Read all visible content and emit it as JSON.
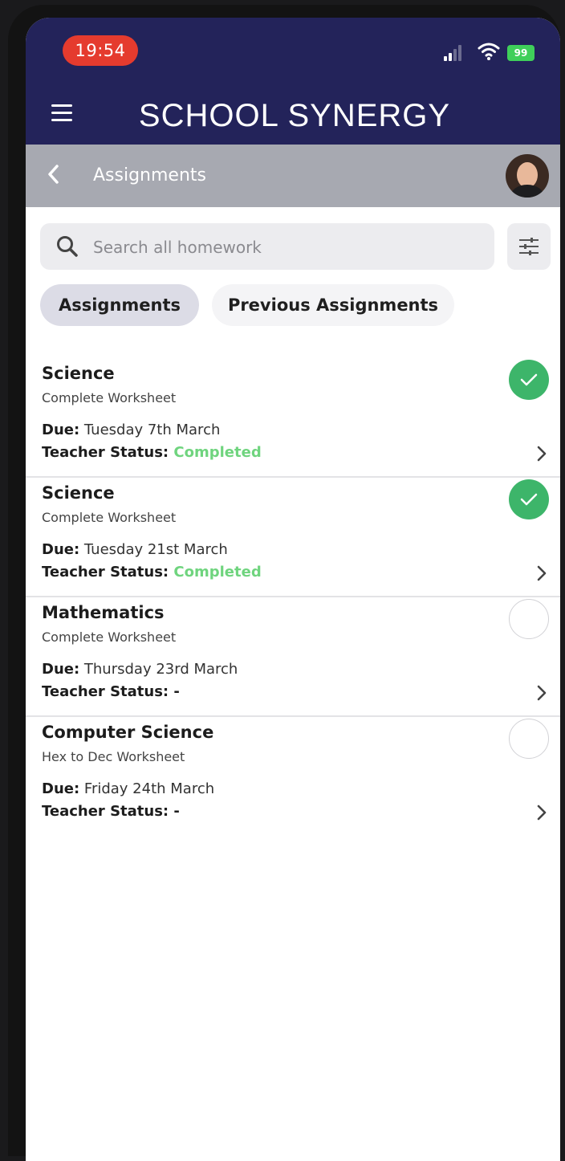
{
  "status_bar": {
    "time": "19:54",
    "battery": "99"
  },
  "header": {
    "brand": "SCHOOL SYNERGY"
  },
  "subheader": {
    "title": "Assignments"
  },
  "search": {
    "placeholder": "Search all homework"
  },
  "tabs": [
    {
      "label": "Assignments",
      "active": true
    },
    {
      "label": "Previous Assignments",
      "active": false
    }
  ],
  "labels": {
    "due": "Due:",
    "teacher_status": "Teacher Status:"
  },
  "assignments": [
    {
      "subject": "Science",
      "task": "Complete Worksheet",
      "due": "Tuesday 7th March",
      "status": "Completed",
      "done": true
    },
    {
      "subject": "Science",
      "task": "Complete Worksheet",
      "due": "Tuesday 21st March",
      "status": "Completed",
      "done": true
    },
    {
      "subject": "Mathematics",
      "task": "Complete Worksheet",
      "due": "Thursday 23rd March",
      "status": "-",
      "done": false
    },
    {
      "subject": "Computer Science",
      "task": "Hex to Dec Worksheet",
      "due": "Friday 24th March",
      "status": "-",
      "done": false
    }
  ],
  "colors": {
    "header_bg": "#23235a",
    "subheader_bg": "#a7a9b1",
    "done_green": "#3db56a",
    "completed_text": "#6fd47e",
    "time_pill": "#e53b2e"
  },
  "icons": {
    "menu": "hamburger-icon",
    "back": "chevron-left-icon",
    "search": "search-icon",
    "filter": "sliders-icon",
    "done": "checkmark-icon",
    "row": "chevron-right-icon"
  }
}
